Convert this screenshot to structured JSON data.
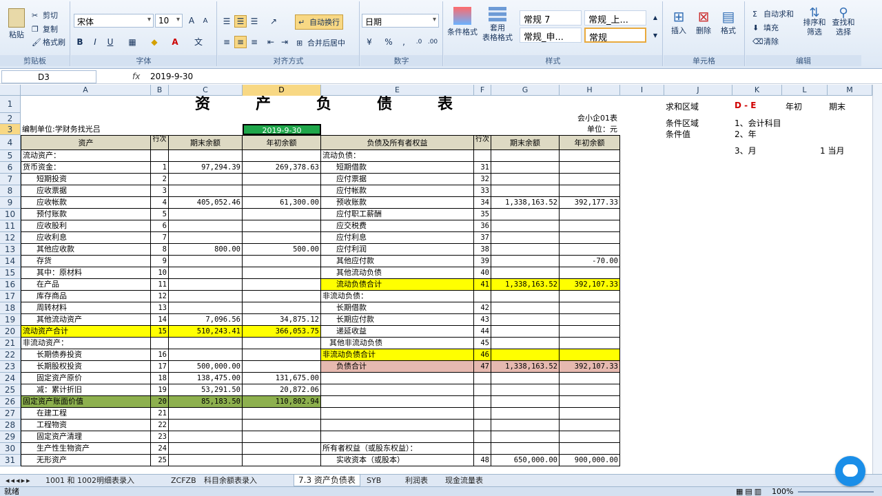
{
  "ribbon": {
    "clipboard": {
      "paste": "粘贴",
      "cut": "剪切",
      "copy": "复制",
      "format_painter": "格式刷",
      "label": "剪贴板"
    },
    "font": {
      "name": "宋体",
      "size": "10",
      "label": "字体"
    },
    "alignment": {
      "wrap": "自动换行",
      "merge": "合并后居中",
      "label": "对齐方式"
    },
    "number": {
      "format": "日期",
      "label": "数字"
    },
    "styles": {
      "cond_format": "条件格式",
      "table_format_1": "套用",
      "table_format_2": "表格格式",
      "s1": "常规 7",
      "s2": "常规_上...",
      "s3": "常规_申...",
      "s4": "常规",
      "label": "样式"
    },
    "cells": {
      "insert": "插入",
      "delete": "删除",
      "format": "格式",
      "label": "单元格"
    },
    "editing": {
      "autosum": "自动求和",
      "fill": "填充",
      "clear": "清除",
      "sort_1": "排序和",
      "sort_2": "筛选",
      "find_1": "查找和",
      "find_2": "选择",
      "label": "编辑"
    }
  },
  "formula_bar": {
    "name_box": "D3",
    "fx": "fx",
    "value": "2019-9-30"
  },
  "columns": [
    "A",
    "B",
    "C",
    "D",
    "E",
    "F",
    "G",
    "H",
    "I",
    "J",
    "K",
    "L",
    "M"
  ],
  "rows": [
    {
      "n": "1",
      "title": "资　　　产　　　负　　　债　　　表"
    },
    {
      "n": "2",
      "right": "会小企01表"
    },
    {
      "n": "3",
      "a": "编制单位:学财务找光吕",
      "d": "2019-9-30",
      "right": "单位：元"
    },
    {
      "n": "4",
      "a": "资产",
      "b": "行次",
      "c": "期末余额",
      "d": "年初余额",
      "e": "负债及所有者权益",
      "f": "行次",
      "g": "期末余额",
      "h": "年初余额"
    },
    {
      "n": "5",
      "a": "流动资产：",
      "e": "流动负债："
    },
    {
      "n": "6",
      "a": "货币资金：",
      "b": "1",
      "c": "97,294.39",
      "d": "269,378.63",
      "e": "短期借款",
      "f": "31"
    },
    {
      "n": "7",
      "a": "短期投资",
      "b": "2",
      "e": "应付票据",
      "f": "32"
    },
    {
      "n": "8",
      "a": "应收票据",
      "b": "3",
      "e": "应付帐款",
      "f": "33"
    },
    {
      "n": "9",
      "a": "应收帐款",
      "b": "4",
      "c": "405,052.46",
      "d": "61,300.00",
      "e": "预收账款",
      "f": "34",
      "g": "1,338,163.52",
      "h": "392,177.33"
    },
    {
      "n": "10",
      "a": "预付账款",
      "b": "5",
      "e": "应付职工薪酬",
      "f": "35"
    },
    {
      "n": "11",
      "a": "应收股利",
      "b": "6",
      "e": "应交税费",
      "f": "36"
    },
    {
      "n": "12",
      "a": "应收利息",
      "b": "7",
      "e": "应付利息",
      "f": "37"
    },
    {
      "n": "13",
      "a": "其他应收款",
      "b": "8",
      "c": "800.00",
      "d": "500.00",
      "e": "应付利润",
      "f": "38"
    },
    {
      "n": "14",
      "a": "存货",
      "b": "9",
      "e": "其他应付款",
      "f": "39",
      "h": "-70.00"
    },
    {
      "n": "15",
      "a": "其中：原材料",
      "b": "10",
      "e": "其他流动负债",
      "f": "40"
    },
    {
      "n": "16",
      "a": "在产品",
      "b": "11",
      "e": "流动负债合计",
      "f": "41",
      "g": "1,338,163.52",
      "h": "392,107.33"
    },
    {
      "n": "17",
      "a": "库存商品",
      "b": "12",
      "e": "非流动负债："
    },
    {
      "n": "18",
      "a": "周转材料",
      "b": "13",
      "e": "长期借款",
      "f": "42"
    },
    {
      "n": "19",
      "a": "其他流动资产",
      "b": "14",
      "c": "7,096.56",
      "d": "34,875.12",
      "e": "长期应付款",
      "f": "43"
    },
    {
      "n": "20",
      "a": "流动资产合计",
      "b": "15",
      "c": "510,243.41",
      "d": "366,053.75",
      "e": "递延收益",
      "f": "44"
    },
    {
      "n": "21",
      "a": "非流动资产：",
      "e": "其他非流动负债",
      "f": "45"
    },
    {
      "n": "22",
      "a": "长期债券投资",
      "b": "16",
      "e": "非流动负债合计",
      "f": "46"
    },
    {
      "n": "23",
      "a": "长期股权投资",
      "b": "17",
      "c": "500,000.00",
      "e": "负债合计",
      "f": "47",
      "g": "1,338,163.52",
      "h": "392,107.33"
    },
    {
      "n": "24",
      "a": "固定资产原价",
      "b": "18",
      "c": "138,475.00",
      "d": "131,675.00"
    },
    {
      "n": "25",
      "a": "减：累计折旧",
      "b": "19",
      "c": "53,291.50",
      "d": "20,872.06"
    },
    {
      "n": "26",
      "a": "固定资产账面价值",
      "b": "20",
      "c": "85,183.50",
      "d": "110,802.94"
    },
    {
      "n": "27",
      "a": "在建工程",
      "b": "21"
    },
    {
      "n": "28",
      "a": "工程物资",
      "b": "22"
    },
    {
      "n": "29",
      "a": "固定资产清理",
      "b": "23"
    },
    {
      "n": "30",
      "a": "生产性生物资产",
      "b": "24",
      "e": "所有者权益（或股东权益）："
    },
    {
      "n": "31",
      "a": "无形资产",
      "b": "25",
      "e": "实收资本（或股本）",
      "f": "48",
      "g": "650,000.00",
      "h": "900,000.00"
    }
  ],
  "side": {
    "sum_area": "求和区域",
    "sum_area_val": "D - E",
    "year_start": "年初",
    "period_end": "期末",
    "cond_area": "条件区域",
    "cond_1": "1、会计科目",
    "cond_2": "2、年",
    "cond_val": "条件值",
    "cond_3": "3、月",
    "current_month": "1 当月"
  },
  "tabs": [
    "1001 和 1002明细表录入",
    "ZCFZB",
    "科目余额表录入",
    "7.3 资产负债表",
    "SYB",
    "利润表",
    "现金流量表"
  ],
  "active_tab": "7.3 资产负债表",
  "status": {
    "ready": "就绪",
    "zoom": "100%"
  }
}
